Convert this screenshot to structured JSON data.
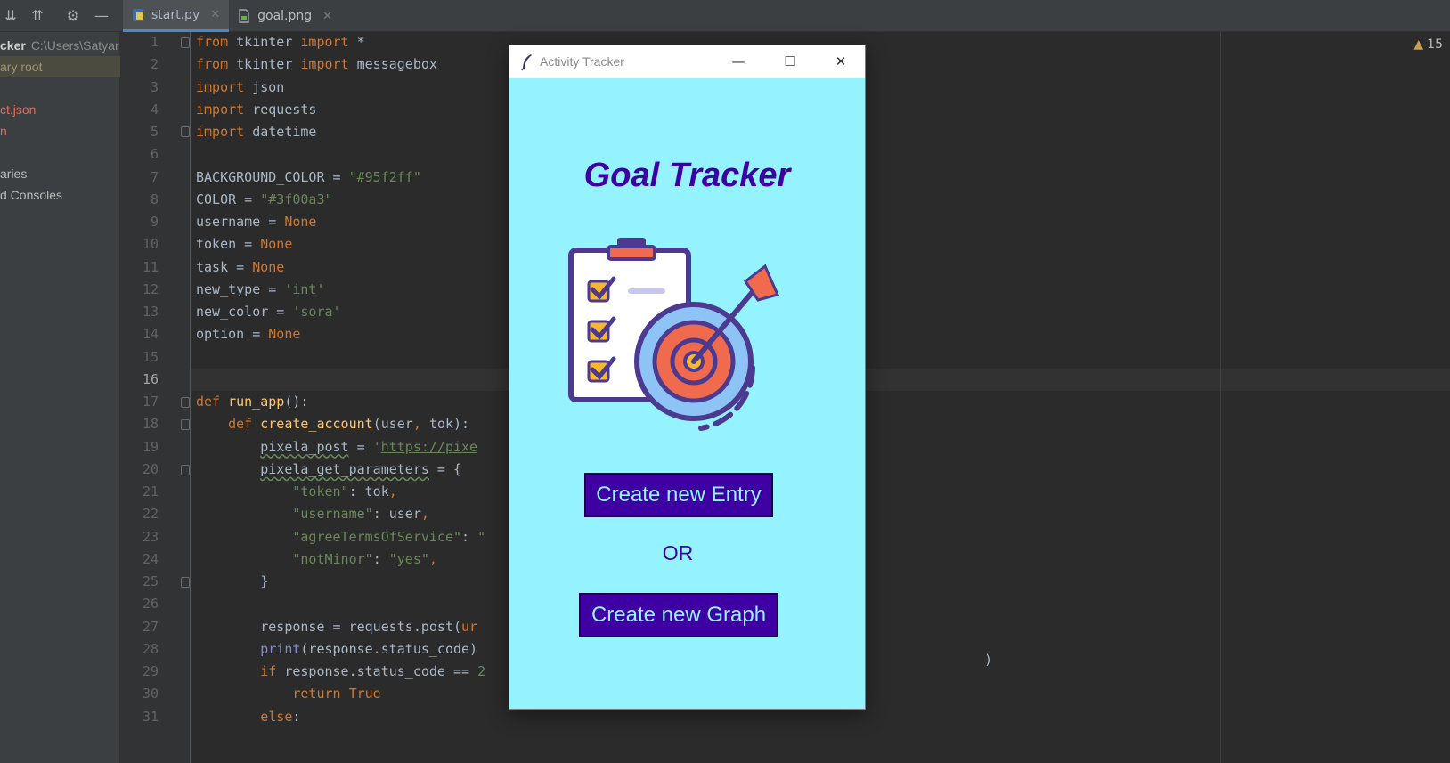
{
  "tabs": [
    {
      "label": "start.py",
      "active": true,
      "icon": "python-file-icon"
    },
    {
      "label": "goal.png",
      "active": false,
      "icon": "image-file-icon"
    }
  ],
  "sidebar": {
    "project_name": "cker",
    "project_path": "C:\\Users\\Satyar",
    "root_label": "ary root",
    "file1": "ct.json",
    "file2": "n",
    "libraries": "aries",
    "consoles": "d Consoles"
  },
  "editor": {
    "warning_count": "15",
    "current_line": 16,
    "line_numbers": [
      "1",
      "2",
      "3",
      "4",
      "5",
      "6",
      "7",
      "8",
      "9",
      "10",
      "11",
      "12",
      "13",
      "14",
      "15",
      "16",
      "17",
      "18",
      "19",
      "20",
      "21",
      "22",
      "23",
      "24",
      "25",
      "26",
      "27",
      "28",
      "29",
      "30",
      "31"
    ],
    "code": {
      "l1": [
        "from",
        " tkinter ",
        "import",
        " *"
      ],
      "l2": [
        "from",
        " tkinter ",
        "import",
        " messagebox"
      ],
      "l3": [
        "import",
        " json"
      ],
      "l4": [
        "import",
        " requests"
      ],
      "l5": [
        "import",
        " datetime"
      ],
      "l7": [
        "BACKGROUND_COLOR = ",
        "\"#95f2ff\""
      ],
      "l8": [
        "COLOR = ",
        "\"#3f00a3\""
      ],
      "l9": [
        "username = ",
        "None"
      ],
      "l10": [
        "token = ",
        "None"
      ],
      "l11": [
        "task = ",
        "None"
      ],
      "l12": [
        "new_type = ",
        "'int'"
      ],
      "l13": [
        "new_color = ",
        "'sora'"
      ],
      "l14": [
        "option = ",
        "None"
      ],
      "l17": [
        "def",
        " ",
        "run_app",
        "():"
      ],
      "l18": [
        "    ",
        "def",
        " ",
        "create_account",
        "(user",
        ",",
        " tok):"
      ],
      "l19": [
        "        ",
        "pixela_post",
        " = ",
        "'",
        "https://pixe"
      ],
      "l20": [
        "        ",
        "pixela_get_parameters",
        " = {"
      ],
      "l21": [
        "            ",
        "\"token\"",
        ": tok",
        ","
      ],
      "l22": [
        "            ",
        "\"username\"",
        ": user",
        ","
      ],
      "l23": [
        "            ",
        "\"agreeTermsOfService\"",
        ": ",
        "\""
      ],
      "l24": [
        "            ",
        "\"notMinor\"",
        ": ",
        "\"yes\"",
        ","
      ],
      "l25": [
        "        }"
      ],
      "l27": [
        "        response = requests.post(",
        "ur"
      ],
      "l28": [
        "        ",
        "print",
        "(response.status_code)"
      ],
      "l29": [
        "        ",
        "if",
        " response.status_code == ",
        "2"
      ],
      "l30": [
        "            ",
        "return",
        " ",
        "True"
      ],
      "l31": [
        "        ",
        "else",
        ":"
      ],
      "l27_tail": ")"
    }
  },
  "tk_window": {
    "title": "Activity Tracker",
    "heading": "Goal Tracker",
    "button_entry": "Create new Entry",
    "or_label": "OR",
    "button_graph": "Create new Graph",
    "background": "#95f2ff",
    "accent": "#3f00a3"
  }
}
